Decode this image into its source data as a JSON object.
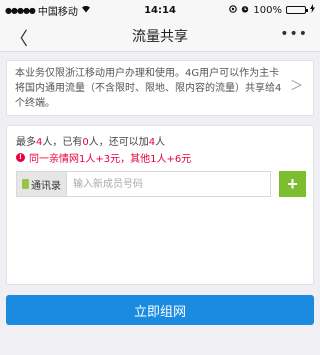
{
  "status_bar": {
    "carrier": "中国移动",
    "time": "14:14",
    "battery": "100%"
  },
  "nav": {
    "title": "流量共享"
  },
  "notice": {
    "text": "本业务仅限浙江移动用户办理和使用。4G用户可以作为主卡将国内通用流量（不含限时、限地、限内容的流量）共享给4个终端。"
  },
  "members": {
    "limit_prefix": "最多",
    "max_count": "4",
    "limit_mid1": "人，已有",
    "current_count": "0",
    "limit_mid2": "人，还可以加",
    "remaining_count": "4",
    "limit_suffix": "人",
    "promo": "同一亲情网1人+3元，其他1人+6元"
  },
  "contact_row": {
    "contacts_label": "通讯录",
    "input_placeholder": "输入新成员号码",
    "input_value": ""
  },
  "actions": {
    "submit_label": "立即组网"
  },
  "colors": {
    "accent_blue": "#1a8be0",
    "highlight_red": "#e8003d",
    "add_green": "#7cbe2f"
  }
}
